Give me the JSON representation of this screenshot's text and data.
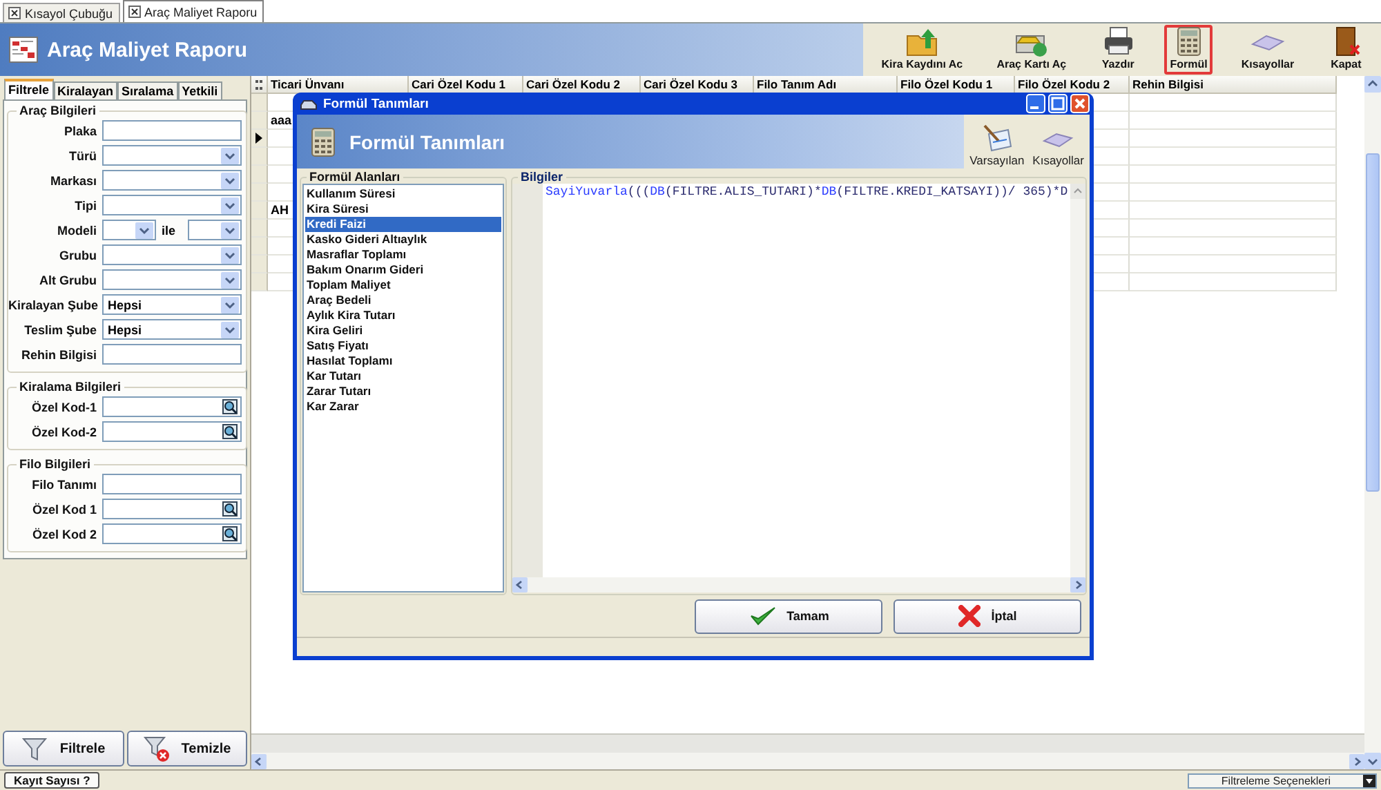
{
  "document_tabs": [
    {
      "label": "Kısayol Çubuğu",
      "selected": false
    },
    {
      "label": "Araç Maliyet Raporu",
      "selected": true
    }
  ],
  "header": {
    "title": "Araç Maliyet Raporu"
  },
  "toolbar": [
    {
      "label": "Kira Kaydını Ac",
      "highlighted": false
    },
    {
      "label": "Araç Kartı Aç",
      "highlighted": false
    },
    {
      "label": "Yazdır",
      "highlighted": false
    },
    {
      "label": "Formül",
      "highlighted": true
    },
    {
      "label": "Kısayollar",
      "highlighted": false
    },
    {
      "label": "Kapat",
      "highlighted": false
    }
  ],
  "filter_tabs": [
    {
      "label": "Filtrele",
      "selected": true
    },
    {
      "label": "Kiralayan",
      "selected": false
    },
    {
      "label": "Sıralama",
      "selected": false
    },
    {
      "label": "Yetkili",
      "selected": false
    }
  ],
  "groups": [
    {
      "title": "Araç Bilgileri",
      "fields": [
        {
          "label": "Plaka",
          "kind": "text"
        },
        {
          "label": "Türü",
          "kind": "combo"
        },
        {
          "label": "Markası",
          "kind": "combo"
        },
        {
          "label": "Tipi",
          "kind": "combo"
        },
        {
          "label": "Modeli",
          "kind": "range",
          "connector": "ile"
        },
        {
          "label": "Grubu",
          "kind": "combo"
        },
        {
          "label": "Alt Grubu",
          "kind": "combo"
        },
        {
          "label": "Kiralayan Şube",
          "kind": "combo",
          "value": "Hepsi"
        },
        {
          "label": "Teslim Şube",
          "kind": "combo",
          "value": "Hepsi"
        },
        {
          "label": "Rehin Bilgisi",
          "kind": "text"
        }
      ]
    },
    {
      "title": "Kiralama Bilgileri",
      "fields": [
        {
          "label": "Özel Kod-1",
          "kind": "lookup"
        },
        {
          "label": "Özel Kod-2",
          "kind": "lookup"
        }
      ]
    },
    {
      "title": "Filo Bilgileri",
      "fields": [
        {
          "label": "Filo Tanımı",
          "kind": "text"
        },
        {
          "label": "Özel Kod 1",
          "kind": "lookup"
        },
        {
          "label": "Özel Kod 2",
          "kind": "lookup"
        }
      ]
    }
  ],
  "filter_buttons": [
    {
      "label": "Filtrele",
      "kind": "filter"
    },
    {
      "label": "Temizle",
      "kind": "clear"
    }
  ],
  "grid": {
    "columns": [
      "Ticari Ünvanı",
      "Cari Özel Kodu 1",
      "Cari Özel Kodu 2",
      "Cari Özel Kodu 3",
      "Filo Tanım Adı",
      "Filo Özel Kodu 1",
      "Filo Özel Kodu 2",
      "Rehin Bilgisi"
    ],
    "rows": [
      {
        "current": false
      },
      {
        "current": false,
        "cells": [
          "aaa"
        ]
      },
      {
        "current": true
      },
      {
        "current": false
      },
      {
        "current": false
      },
      {
        "current": false
      },
      {
        "current": false,
        "cells": [
          "AH"
        ]
      },
      {
        "current": false
      },
      {
        "current": false
      },
      {
        "current": false
      },
      {
        "current": false
      }
    ]
  },
  "dialog": {
    "title": "Formül Tanımları",
    "heading": "Formül Tanımları",
    "tools": [
      {
        "label": "Varsayılan",
        "kind": "defaults"
      },
      {
        "label": "Kısayollar",
        "kind": "shortcuts"
      }
    ],
    "fields_title": "Formül Alanları",
    "fields": [
      {
        "label": "Kullanım Süresi",
        "selected": false
      },
      {
        "label": "Kira Süresi",
        "selected": false
      },
      {
        "label": "Kredi Faizi",
        "selected": true
      },
      {
        "label": "Kasko Gideri Altıaylık",
        "selected": false
      },
      {
        "label": "Masraflar Toplamı",
        "selected": false
      },
      {
        "label": "Bakım Onarım Gideri",
        "selected": false
      },
      {
        "label": "Toplam Maliyet",
        "selected": false
      },
      {
        "label": "Araç Bedeli",
        "selected": false
      },
      {
        "label": "Aylık Kira Tutarı",
        "selected": false
      },
      {
        "label": "Kira Geliri",
        "selected": false
      },
      {
        "label": "Satış Fiyatı",
        "selected": false
      },
      {
        "label": "Hasılat Toplamı",
        "selected": false
      },
      {
        "label": "Kar Tutarı",
        "selected": false
      },
      {
        "label": "Zarar Tutarı",
        "selected": false
      },
      {
        "label": "Kar Zarar",
        "selected": false
      }
    ],
    "info_title": "Bilgiler",
    "formula": "SayiYuvarla(((DB(FILTRE.ALIS_TUTARI)*DB(FILTRE.KREDI_KATSAYI))/ 365)*D",
    "buttons": [
      {
        "label": "Tamam",
        "kind": "ok"
      },
      {
        "label": "İptal",
        "kind": "cancel"
      }
    ]
  },
  "status_bar": {
    "record_count_button": "Kayıt Sayısı ?",
    "filter_options": "Filtreleme Seçenekleri"
  }
}
